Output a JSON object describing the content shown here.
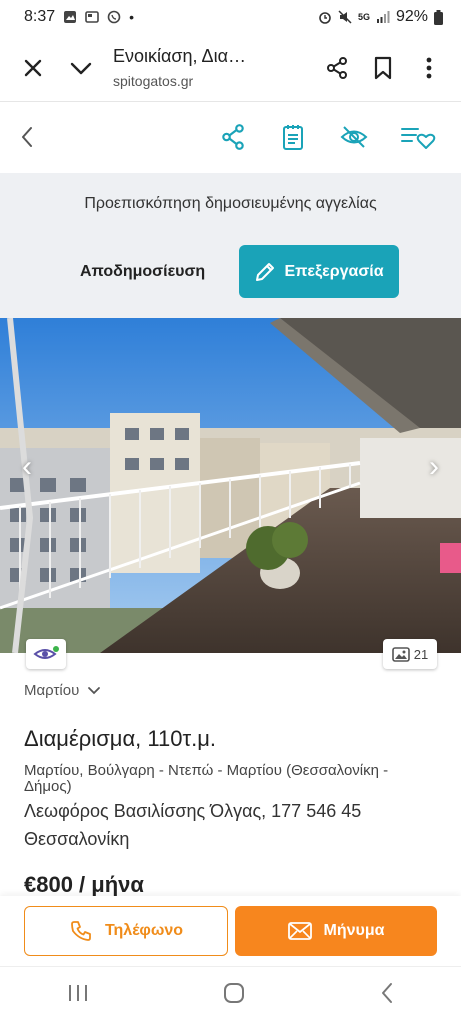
{
  "status_bar": {
    "time": "8:37",
    "network": "5G",
    "battery": "92%"
  },
  "browser": {
    "title": "Ενοικίαση, Δια…",
    "url": "spitogatos.gr"
  },
  "preview": {
    "message": "Προεπισκόπηση δημοσιευμένης αγγελίας",
    "unpublish_label": "Αποδημοσίευση",
    "edit_label": "Επεξεργασία"
  },
  "photo": {
    "count": "21"
  },
  "listing": {
    "month_label": "Μαρτίου",
    "title": "Διαμέρισμα, 110τ.μ.",
    "area": "Μαρτίου, Βούλγαρη - Ντεπώ - Μαρτίου (Θεσσαλονίκη - Δήμος)",
    "address": "Λεωφόρος Βασιλίσσης Όλγας, 177 546 45 Θεσσαλονίκη",
    "price": "€800 / μήνα"
  },
  "cta": {
    "phone_label": "Τηλέφωνο",
    "message_label": "Μήνυμα"
  },
  "colors": {
    "teal": "#1aa3b8",
    "orange": "#f7861e",
    "panel_bg": "#eef0f3"
  },
  "icons": [
    "close-icon",
    "chevron-down-icon",
    "share-icon",
    "bookmark-icon",
    "more-vert-icon",
    "back-chevron-icon",
    "notes-icon",
    "hide-eye-icon",
    "list-heart-icon",
    "pencil-icon",
    "phone-icon",
    "mail-icon",
    "gallery-icon",
    "eye-icon"
  ]
}
